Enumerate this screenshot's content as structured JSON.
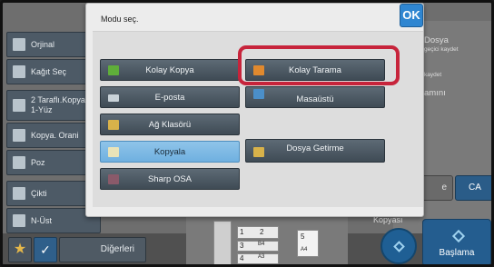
{
  "background": {
    "sidebar": [
      {
        "label": "Orjinal",
        "icon": "document-icon"
      },
      {
        "label": "Kağıt Seç",
        "icon": "paper-icon"
      },
      {
        "label": "2 Taraflı.Kopya\n1-Yüz",
        "icon": "duplex-icon"
      },
      {
        "label": "Kopya. Orani",
        "icon": "zoom-icon"
      },
      {
        "label": "Poz",
        "icon": "exposure-icon"
      },
      {
        "label": "Çikti",
        "icon": "output-icon"
      },
      {
        "label": "N-Üst",
        "icon": "n-up-icon"
      }
    ],
    "bottom": {
      "others_label": "Diğerleri"
    },
    "right": {
      "line1": "Dosya",
      "line2": "geçici kaydet",
      "line3": "kaydet",
      "line4": "amını",
      "e_label": "e",
      "ca_label": "CA",
      "copies_label": "Kopyası",
      "start_label": "Başlama"
    },
    "preview": {
      "tray1": "1",
      "tray2": "2",
      "tray3": "3",
      "tray4": "4",
      "tray5": "5",
      "size_a4": "A4",
      "size_b4": "B4",
      "size_a3": "A3"
    }
  },
  "dialog": {
    "title": "Modu seç.",
    "ok_label": "OK",
    "modes": [
      {
        "label": "Kolay Kopya",
        "icon": "easy-copy-icon",
        "icon_color": "#5fae3a"
      },
      {
        "label": "Kolay Tarama",
        "icon": "easy-scan-icon",
        "icon_color": "#e0892e",
        "highlighted": true
      },
      {
        "label": "E-posta",
        "icon": "email-icon",
        "icon_color": "#c9d2d8"
      },
      {
        "label": "Masaüstü",
        "icon": "desktop-icon",
        "icon_color": "#4b8fc9"
      },
      {
        "label": "Ağ Klasörü",
        "icon": "network-folder-icon",
        "icon_color": "#d8b24a"
      },
      {
        "label": "Kopyala",
        "icon": "copy-icon",
        "icon_color": "#e9e3b8",
        "active": true
      },
      {
        "label": "Dosya Getirme",
        "icon": "document-filing-icon",
        "icon_color": "#d8b24a"
      },
      {
        "label": "Sharp OSA",
        "icon": "sharp-osa-icon",
        "icon_color": "#8a5a6a"
      }
    ]
  },
  "colors": {
    "accent": "#2f86d1",
    "highlight": "#c7243b",
    "active_mode": "#7fb9e5"
  }
}
